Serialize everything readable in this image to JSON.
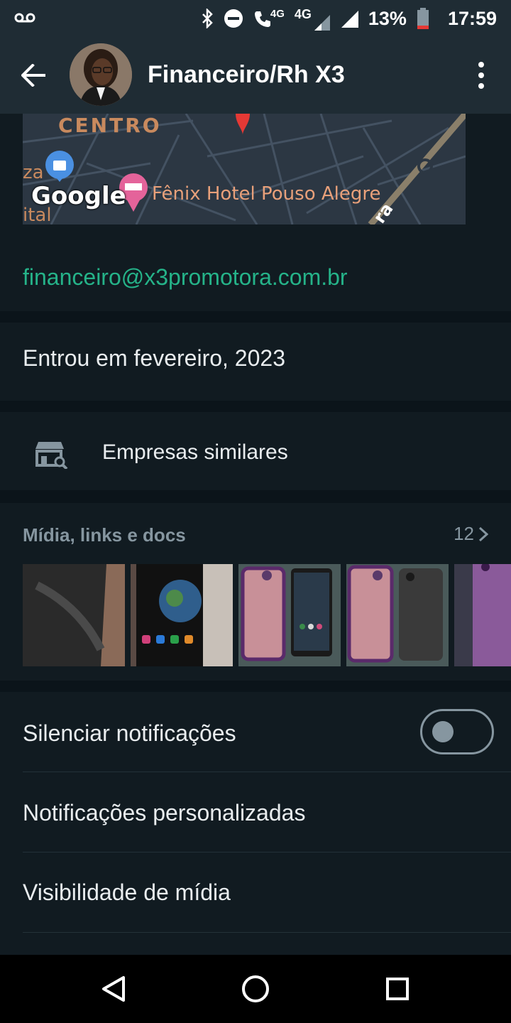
{
  "status_bar": {
    "network_small": "4G",
    "network": "4G",
    "battery": "13%",
    "time": "17:59"
  },
  "header": {
    "title": "Financeiro/Rh X3"
  },
  "map": {
    "label_centro": "CENTRO",
    "label_za": "za",
    "label_ital": "ital",
    "google": "Google",
    "hotel": "Fênix Hotel Pouso Alegre",
    "road": "ra"
  },
  "contact": {
    "email": "financeiro@x3promotora.com.br"
  },
  "joined": {
    "text": "Entrou em fevereiro, 2023"
  },
  "similar": {
    "label": "Empresas similares"
  },
  "media": {
    "title": "Mídia, links e docs",
    "count": "12"
  },
  "settings": {
    "mute_label": "Silenciar notificações",
    "mute_enabled": false,
    "custom_notifications_label": "Notificações personalizadas",
    "media_visibility_label": "Visibilidade de mídia"
  },
  "colors": {
    "accent_link": "#25b389",
    "background": "#0b141a",
    "surface": "#111b21",
    "header": "#1f2c34"
  }
}
